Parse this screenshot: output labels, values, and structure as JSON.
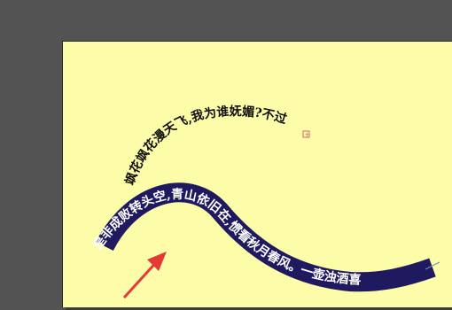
{
  "colors": {
    "workspace": "#535353",
    "paper": "#fdfca9",
    "band_fill": "#1f1a60",
    "band_text": "#ffffff",
    "arc_text": "#111111",
    "arrow": "#e53935",
    "path_line": "#6a8fc4"
  },
  "document": {
    "arc_text": "飒花飒花漫天飞,我为谁妩媚?不过",
    "band_text": "是非成败转头空,青山依旧在,惯看秋月春风。一壶浊酒喜",
    "overflow_marker": "+"
  },
  "annotation": {
    "arrow_icon": "red-arrow-icon"
  }
}
